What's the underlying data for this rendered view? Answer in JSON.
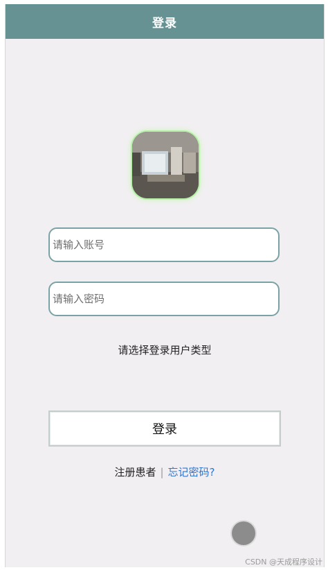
{
  "header": {
    "title": "登录"
  },
  "form": {
    "account_placeholder": "请输入账号",
    "password_placeholder": "请输入密码",
    "user_type_prompt": "请选择登录用户类型",
    "login_label": "登录"
  },
  "links": {
    "register": "注册患者",
    "separator": "|",
    "forgot": "忘记密码?"
  },
  "watermark": "CSDN @天成程序设计",
  "colors": {
    "header": "#679294",
    "input_border": "#7aa2a4",
    "link": "#2f74d0",
    "background": "#f2eff2"
  },
  "icons": {
    "avatar": "app-logo-image",
    "fab": "floating-circle-button"
  }
}
